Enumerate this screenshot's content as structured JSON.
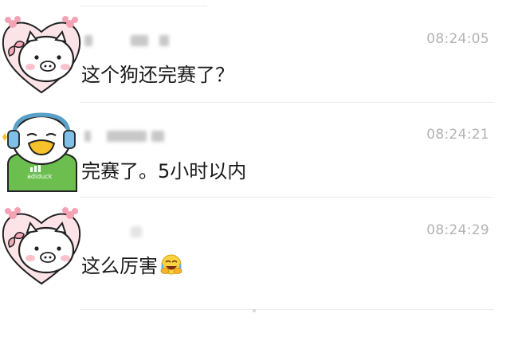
{
  "messages": [
    {
      "avatar": "pig-heart-avatar",
      "sender": "",
      "time": "08:24:05",
      "text": "这个狗还完赛了？"
    },
    {
      "avatar": "duck-headphones-avatar",
      "sender": "",
      "time": "08:24:21",
      "text": "完赛了。5小时以内",
      "shirt_text": "adiduck"
    },
    {
      "avatar": "pig-heart-avatar",
      "sender": "",
      "time": "08:24:29",
      "text": "这么厉害",
      "emoji": "laughing-crying-emoji"
    }
  ],
  "colors": {
    "text": "#1a1a1a",
    "time": "#b3b3b3",
    "divider": "#ececec",
    "heart": "#f7c6cf",
    "duck_shirt": "#6cbf4e"
  }
}
